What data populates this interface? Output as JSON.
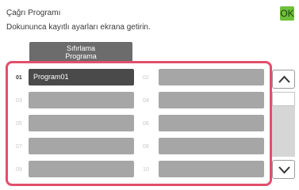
{
  "header": {
    "title": "Çağrı Programı",
    "subtitle": "Dokununca kayıtlı ayarları ekrana getirin.",
    "ok_label": "OK"
  },
  "reset_button": {
    "line1": "Sıfırlama",
    "line2": "Programa"
  },
  "programs": [
    {
      "num": "01",
      "label": "Program01",
      "filled": true
    },
    {
      "num": "02",
      "label": "",
      "filled": false
    },
    {
      "num": "03",
      "label": "",
      "filled": false
    },
    {
      "num": "04",
      "label": "",
      "filled": false
    },
    {
      "num": "05",
      "label": "",
      "filled": false
    },
    {
      "num": "06",
      "label": "",
      "filled": false
    },
    {
      "num": "07",
      "label": "",
      "filled": false
    },
    {
      "num": "08",
      "label": "",
      "filled": false
    },
    {
      "num": "09",
      "label": "",
      "filled": false
    },
    {
      "num": "10",
      "label": "",
      "filled": false
    }
  ],
  "scroll": {
    "up_icon": "chevron-up-icon",
    "down_icon": "chevron-down-icon"
  },
  "colors": {
    "accent_border": "#e0506c",
    "ok_green": "#6fbf3a",
    "slot_empty": "#a6a6a6",
    "slot_filled": "#4a4a4a"
  }
}
